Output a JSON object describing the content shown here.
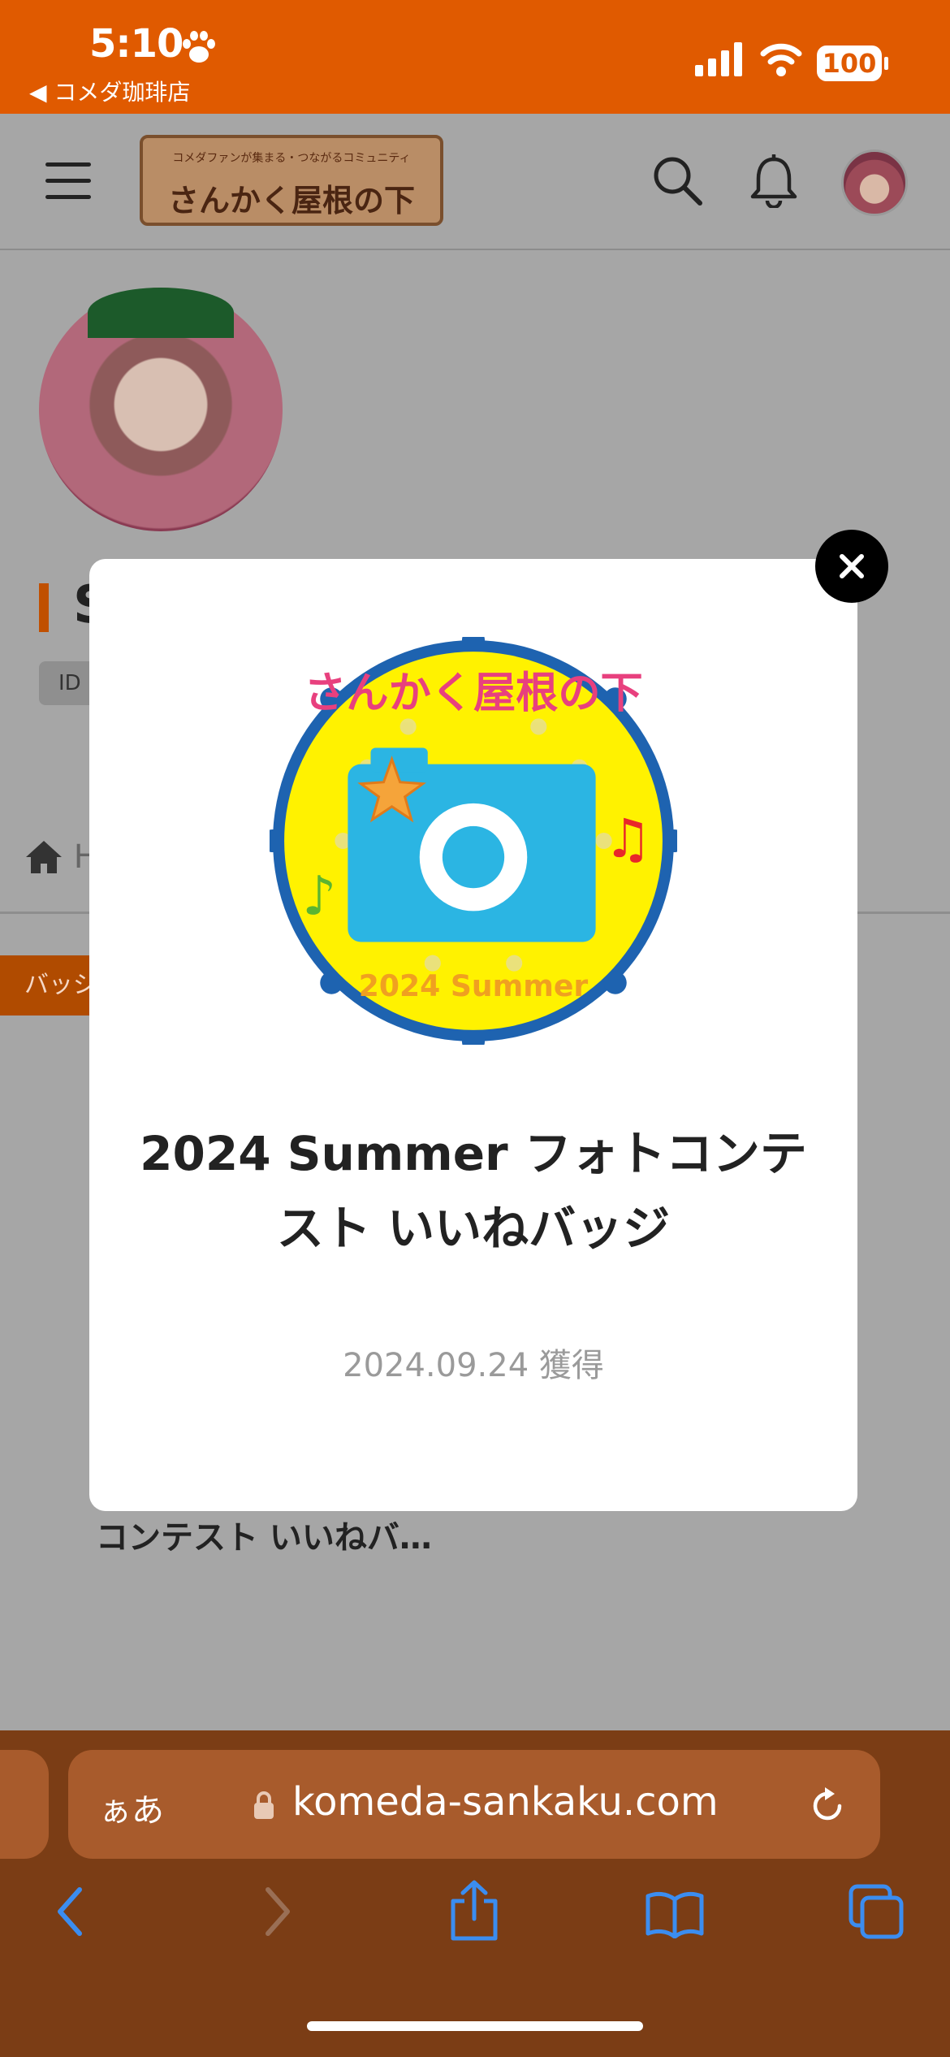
{
  "status_bar": {
    "time": "5:10",
    "back_app": "◀ コメダ珈琲店",
    "battery": "100"
  },
  "header": {
    "logo_tagline": "コメダファンが集まる・つながるコミュニティ",
    "logo_name": "さんかく屋根の下"
  },
  "profile": {
    "name_initial": "S",
    "id_label": "ID"
  },
  "tabs": {
    "home_partial": "H"
  },
  "badge_tab": {
    "label": "バッジ"
  },
  "badge_card": {
    "title": "2024 Summer フォト コンテスト いいねバ…"
  },
  "modal": {
    "badge_ring_text": "さんかく屋根の下",
    "badge_year_text": "2024 Summer",
    "title": "2024 Summer フォトコンテスト いいねバッジ",
    "date": "2024.09.24 獲得"
  },
  "browser": {
    "text_size_label": "ぁあ",
    "url": "komeda-sankaku.com"
  },
  "colors": {
    "status_orange": "#e05a00",
    "browser_brown": "#7b3d15",
    "badge_blue": "#1e63b0",
    "badge_yellow": "#fff200",
    "camera_blue": "#2bb5e3",
    "accent_orange": "#c05000"
  },
  "icons": [
    "paw-icon",
    "signal-icon",
    "wifi-icon",
    "menu-icon",
    "search-icon",
    "bell-icon",
    "home-icon",
    "close-icon",
    "lock-icon",
    "reload-icon",
    "back-icon",
    "forward-icon",
    "share-icon",
    "bookmarks-icon",
    "tabs-icon"
  ]
}
